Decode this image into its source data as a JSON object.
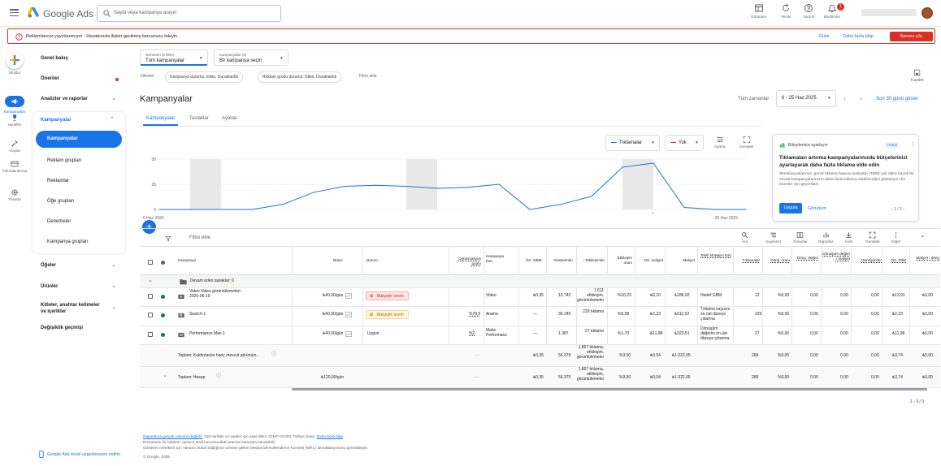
{
  "header": {
    "brand": "Google Ads",
    "search_placeholder": "Sayfa veya kampanya arayın",
    "actions": [
      {
        "label": "Görünüm",
        "icon": "appearance-icon"
      },
      {
        "label": "Yenile",
        "icon": "refresh-icon"
      },
      {
        "label": "Yardım",
        "icon": "help-icon"
      },
      {
        "label": "Bildirimler",
        "icon": "bell-icon"
      }
    ],
    "notification_count": "1"
  },
  "alert": {
    "text": "Reklamlarınız yayınlanmıyor - Hesabınızla ilişkin gecikmiş borcunuzu ödeyin.",
    "hide": "Gizle",
    "more": "Daha fazla bilgi",
    "fix": "Sorunu çöz"
  },
  "rail": [
    {
      "label": "Oluştur",
      "icon": "plus-icon"
    },
    {
      "label": "Kampanyalar",
      "icon": "megaphone-icon",
      "active": true
    },
    {
      "label": "Hedefler",
      "icon": "trophy-icon"
    },
    {
      "label": "Araçlar",
      "icon": "tools-icon"
    },
    {
      "label": "Faturalandırma",
      "icon": "card-icon"
    },
    {
      "label": "Yönetici",
      "icon": "gear-icon"
    }
  ],
  "nav": {
    "overview": "Genel bakış",
    "recommendations": "Öneriler",
    "insights": "Analizler ve raporlar",
    "campaigns_header": "Kampanyalar",
    "sub": [
      "Kampanyalar",
      "Reklam grupları",
      "Reklamlar",
      "Öğe grupları",
      "Denemeler",
      "Kampanya grupları"
    ],
    "assets": "Öğeler",
    "products": "Ürünler",
    "audiences": "Kitleler, anahtar kelimeler ve içerikler",
    "history": "Değişiklik geçmişi",
    "mobile": "Google Ads mobil uygulamasını indirin"
  },
  "filters": {
    "view_label": "Görünüm (2 filtre)",
    "view_value": "Tüm kampanyalar",
    "camp_label": "Kampanyalar (3)",
    "camp_value": "Bir kampanya seçin",
    "filters_label": "Filtreler",
    "chips": [
      "Kampanya durumu: Etkin, Duraklatıldı",
      "Reklam grubu durumu: Etkin, Duraklatıldı"
    ],
    "add": "Filtre ekle",
    "save": "Kaydet"
  },
  "page": {
    "title": "Kampanyalar",
    "timezone": "Tüm zamanlar",
    "date_range": "6 - 25 Haz 2025",
    "last30": "Son 30 günü göster",
    "tabs": [
      "Kampanyalar",
      "Taslaklar",
      "Ayarlar"
    ]
  },
  "chart_controls": {
    "metric1": "Tıklamalar",
    "metric1_color": "#1a73e8",
    "metric2": "Yok",
    "metric2_color": "#d93025",
    "adjust": "Ayarla",
    "expand": "Genişlet"
  },
  "chart_data": {
    "type": "line",
    "x": [
      "6 Haz 2025",
      "7 Haz 2025",
      "8 Haz 2025",
      "9 Haz 2025",
      "10 Haz 2025",
      "11 Haz 2025",
      "12 Haz 2025",
      "13 Haz 2025",
      "14 Haz 2025",
      "15 Haz 2025",
      "16 Haz 2025",
      "17 Haz 2025",
      "18 Haz 2025",
      "19 Haz 2025",
      "20 Haz 2025",
      "21 Haz 2025",
      "22 Haz 2025",
      "23 Haz 2025",
      "24 Haz 2025",
      "25 Haz 2025"
    ],
    "series": [
      {
        "name": "Tıklamalar",
        "values": [
          0,
          0,
          0,
          0,
          5,
          17,
          23,
          24,
          23,
          21,
          22,
          25,
          0,
          5,
          13,
          42,
          46,
          2,
          0,
          0
        ]
      }
    ],
    "yticks": [
      "50",
      "25",
      "0"
    ],
    "ylim": [
      0,
      50
    ],
    "x_start_label": "6 Haz 2025",
    "x_end_label": "25 Haz 2025",
    "weekend_bands": [
      [
        1,
        2
      ],
      [
        8,
        9
      ],
      [
        15,
        16
      ]
    ],
    "line_color": "#1a73e8"
  },
  "card": {
    "title": "Bütçelerinizi ayarlayın",
    "badge": "+%5,6",
    "headline": "Tıklamaları artırma kampanyalarınızda bütçelerinizi ayarlayarak daha fazla tıklama elde edin",
    "description": "Simülasyonlarımız, genel tıklama başına maliyette (TBM) çok daha küçük bir artışla kampanyalarınızın daha fazla tıklama alabileceğini gösteriyor (bu öneriler için geçerlidir).",
    "apply": "Uygula",
    "view": "Görünüm",
    "pager": "1 / 2"
  },
  "table": {
    "filter_add": "Filtre ekle",
    "tools": [
      "Ara",
      "Segment",
      "Sütunlar",
      "Raporlar",
      "İndir",
      "Genişlet",
      "Diğer"
    ],
    "headers": [
      "Kampanya",
      "Bütçe",
      "Durum",
      "Optimizasyon puanı",
      "Kampanya türü",
      "Ort. GBM",
      "Gösterimler",
      "Etkileşimler",
      "Etkileşim oranı",
      "Ort. maliyet",
      "Maliyet",
      "Teklif stratejisi türü",
      "Tıklamalar",
      "Dönş. oranı",
      "Dönş. değeri",
      "Dönüşüm değeri / maliyet",
      "Dönüşümler",
      "Ort. TBM",
      "Maliyet / dönş."
    ],
    "group_row": "Devam eden taslaklar: 0",
    "rows": [
      {
        "name": "Video Video görüntülemeleri - 2025-06-19",
        "budget": "₺40,00/gün",
        "status": "Bütçeyle sınırlı",
        "status_kind": "red",
        "opt": "",
        "type": "Video",
        "gbm": "₺0,35",
        "impr": "15.743",
        "inter": "1.611 etkileşim, görüntülemeler",
        "irate": "%10,23",
        "avgcost": "₺0,10",
        "cost": "₺186,92",
        "bid": "Hedef GBM",
        "clicks": "12",
        "cvr": "%0,00",
        "cval": "0,00",
        "cvc": "0,00",
        "conv": "0,00",
        "cpc": "₺13,91",
        "cpa": "₺0,00",
        "dot": "#188038",
        "icon": "video"
      },
      {
        "name": "Search-1",
        "budget": "₺40,00/gün",
        "status": "Bütçeyle sınırlı",
        "status_kind": "org",
        "opt": "%78,5",
        "type": "Arama",
        "gbm": "—",
        "impr": "39.249",
        "inter": "229 tıklama",
        "irate": "%0,58",
        "avgcost": "₺2,23",
        "cost": "₺511,62",
        "bid": "Tıklama sayısını en üst düzeye çıkarma",
        "clicks": "229",
        "cvr": "%0,00",
        "cval": "0,00",
        "cvc": "0,00",
        "conv": "0,00",
        "cpc": "₺2,23",
        "cpa": "₺0,00",
        "dot": "#188038",
        "icon": "search"
      },
      {
        "name": "Performance Max-1",
        "budget": "₺40,00/gün",
        "status": "Uygun",
        "status_kind": "none",
        "opt": "%2",
        "type": "Maks. Performans",
        "gbm": "—",
        "impr": "1.387",
        "inter": "27 tıklama",
        "irate": "%1,70",
        "avgcost": "₺11,98",
        "cost": "₺323,51",
        "bid": "Dönüşüm değerini en üst düzeye çıkarma",
        "clicks": "27",
        "cvr": "%0,00",
        "cval": "0,00",
        "cvc": "0,00",
        "conv": "0,00",
        "cpc": "₺11,98",
        "cpa": "₺0,00",
        "dot": "#188038",
        "icon": "pmax"
      }
    ],
    "total1": {
      "label": "Toplam: Kaldırılanlar hariç mevcut görünüm...",
      "budget": "—",
      "opt": "—",
      "gbm": "₺0,35",
      "impr": "56.379",
      "inter": "1.867 tıklama, etkileşim, görüntülemeler",
      "irate": "%3,30",
      "avgcost": "₺0,54",
      "cost": "₺1.022,05",
      "clicks": "268",
      "cvr": "%0,00",
      "cval": "0,00",
      "cvc": "0,00",
      "conv": "0,00",
      "cpc": "₺3,74",
      "cpa": "₺0,00"
    },
    "total2": {
      "label": "Toplam: Hesap",
      "budget": "₺120,00/gün",
      "opt": "—",
      "gbm": "₺0,35",
      "impr": "56.379",
      "inter": "1.867 tıklama, etkileşim, görüntülemeler",
      "irate": "%3,30",
      "avgcost": "₺0,54",
      "cost": "₺1.022,05",
      "clicks": "268",
      "cvr": "%0,00",
      "cval": "0,00",
      "cvc": "0,00",
      "conv": "0,00",
      "cpc": "₺3,74",
      "cpa": "₺0,00"
    },
    "pagination": "1 - 3 / 3"
  },
  "footer": {
    "line1_link": "Raporlama gerçek zamanlı değildir.",
    "line1": " Tüm tarihler ve saatler için saat dilimi: (GMT+03:00) Türkiye Saati.",
    "line1_more": "Daha fazla bilgi",
    "line2": "Envanterin bir bölümü, üçüncü taraf konumundaki aracılar kanalıyla sunulabilir.",
    "line3": "Gösterim metrikleri için Yaratıcı Sütun bağlığının üzerine gelinir Medya Derecelendirme Konseyi (MRC) akreditasyonunu görüntüleyin.",
    "copyright": "© Google, 2025."
  }
}
